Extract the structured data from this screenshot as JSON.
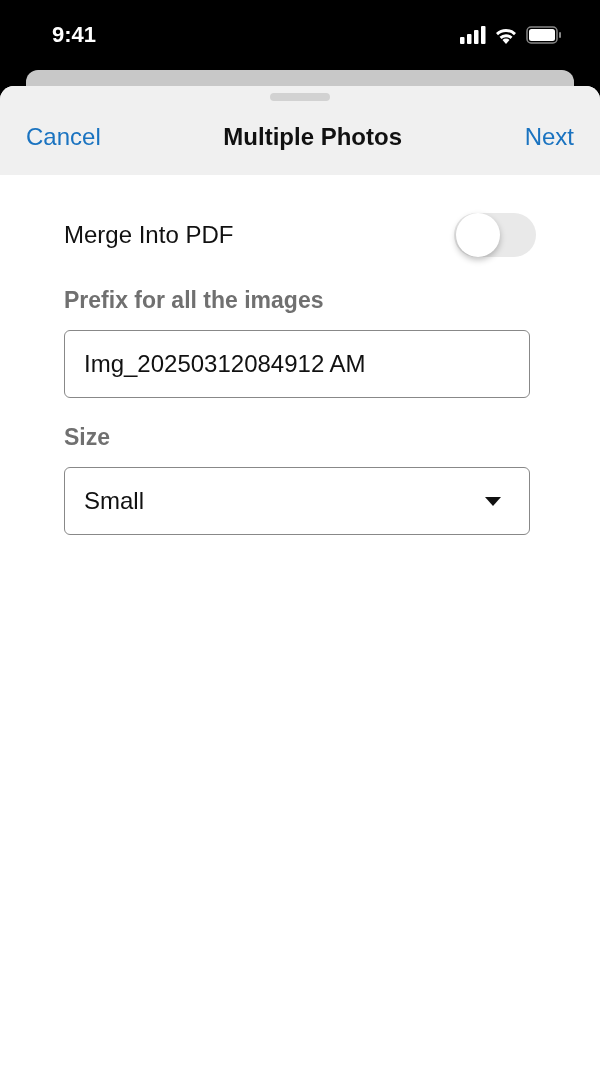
{
  "status_bar": {
    "time": "9:41"
  },
  "nav": {
    "cancel": "Cancel",
    "title": "Multiple Photos",
    "next": "Next"
  },
  "merge": {
    "label": "Merge Into PDF",
    "on": false
  },
  "prefix": {
    "label": "Prefix for all the images",
    "value": "Img_20250312084912 AM"
  },
  "size": {
    "label": "Size",
    "value": "Small"
  }
}
